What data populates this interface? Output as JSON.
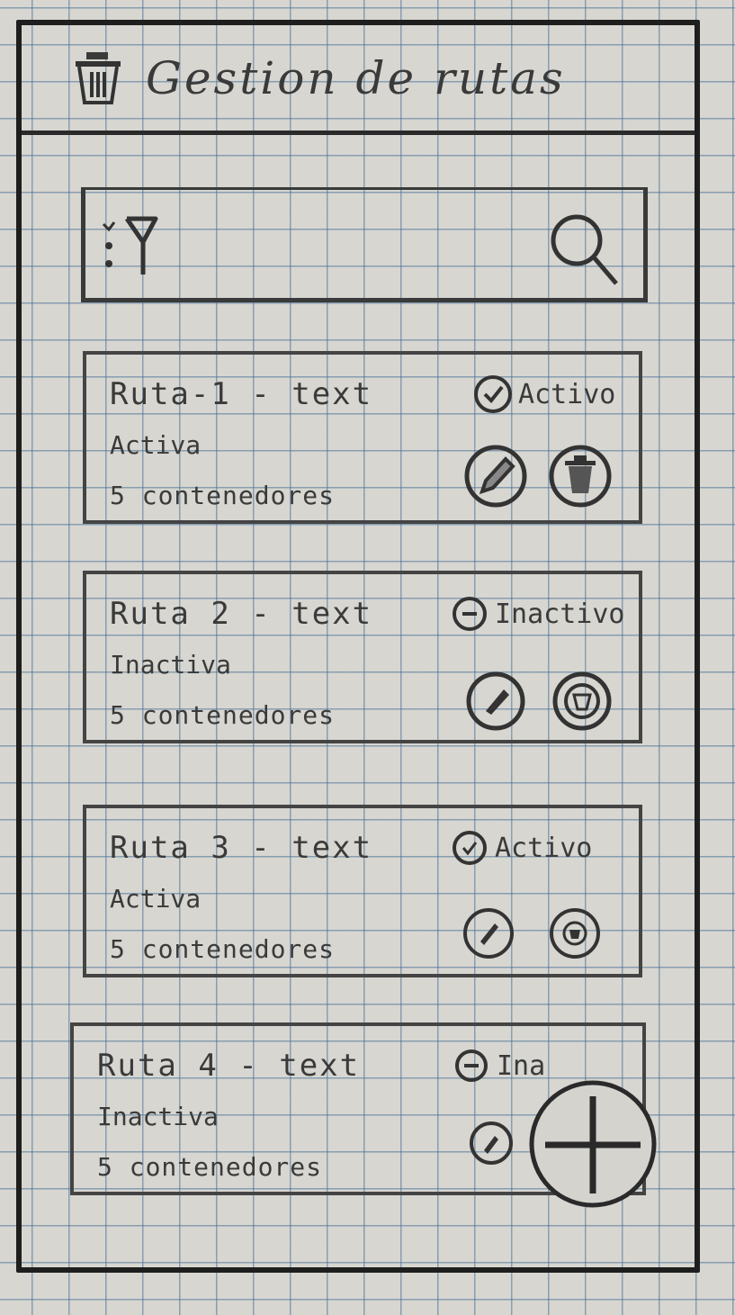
{
  "app": {
    "title": "Gestion de rutas",
    "logo_icon": "trash-icon"
  },
  "toolbar": {
    "filter_icon": "filter-icon",
    "search_icon": "search-icon"
  },
  "routes": [
    {
      "name": "Ruta-1 - text",
      "status": "Activa",
      "count": "5 contenedores",
      "state_label": "Activo"
    },
    {
      "name": "Ruta 2 - text",
      "status": "Inactiva",
      "count": "5 contenedores",
      "state_label": "Inactivo"
    },
    {
      "name": "Ruta 3 - text",
      "status": "Activa",
      "count": "5 contenedores",
      "state_label": "Activo"
    },
    {
      "name": "Ruta 4 - text",
      "status": "Inactiva",
      "count": "5 contenedores",
      "state_label": "Ina"
    }
  ],
  "fab": {
    "icon": "plus-icon"
  }
}
